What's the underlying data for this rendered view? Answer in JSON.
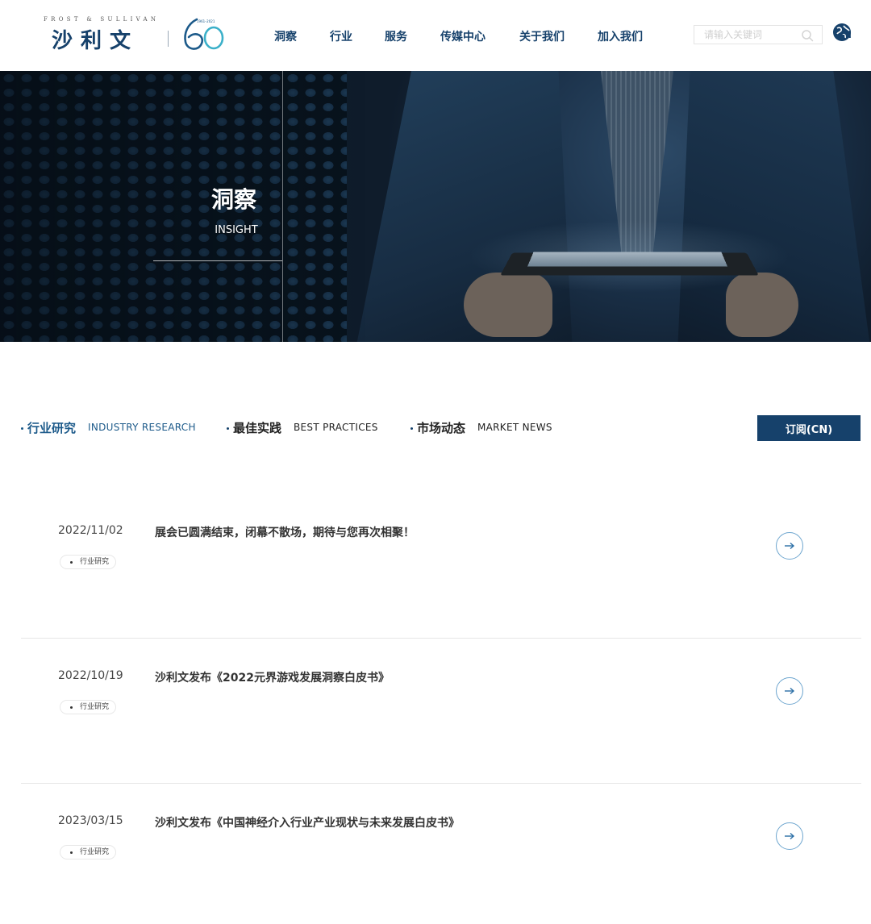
{
  "header": {
    "logo_top": "FROST & SULLIVAN",
    "logo_cn": "沙利文",
    "logo_anniv_small": "1961–2021",
    "nav": [
      {
        "label": "洞察"
      },
      {
        "label": "行业"
      },
      {
        "label": "服务"
      },
      {
        "label": "传媒中心"
      },
      {
        "label": "关于我们"
      },
      {
        "label": "加入我们"
      }
    ],
    "search_placeholder": "请输入关键词",
    "lang_label": "EN"
  },
  "banner": {
    "title": "洞察",
    "subtitle": "INSIGHT"
  },
  "tabs": [
    {
      "cn": "行业研究",
      "en": "INDUSTRY RESEARCH",
      "active": true
    },
    {
      "cn": "最佳实践",
      "en": "BEST PRACTICES",
      "active": false
    },
    {
      "cn": "市场动态",
      "en": "MARKET NEWS",
      "active": false
    }
  ],
  "subscribe_label": "订阅(CN)",
  "articles": [
    {
      "date": "2022/11/02",
      "title": "展会已圆满结束，闭幕不散场，期待与您再次相聚！",
      "tag": "行业研究"
    },
    {
      "date": "2022/10/19",
      "title": "沙利文发布《2022元界游戏发展洞察白皮书》",
      "tag": "行业研究"
    },
    {
      "date": "2023/03/15",
      "title": "沙利文发布《中国神经介入行业产业现状与未来发展白皮书》",
      "tag": "行业研究"
    }
  ],
  "colors": {
    "brand": "#16416b",
    "accent": "#1c5a8a",
    "arrow_ring": "#6ea6cf"
  },
  "icons": {
    "search": "search-icon",
    "language": "globe-icon",
    "article_link": "arrow-right-icon"
  }
}
